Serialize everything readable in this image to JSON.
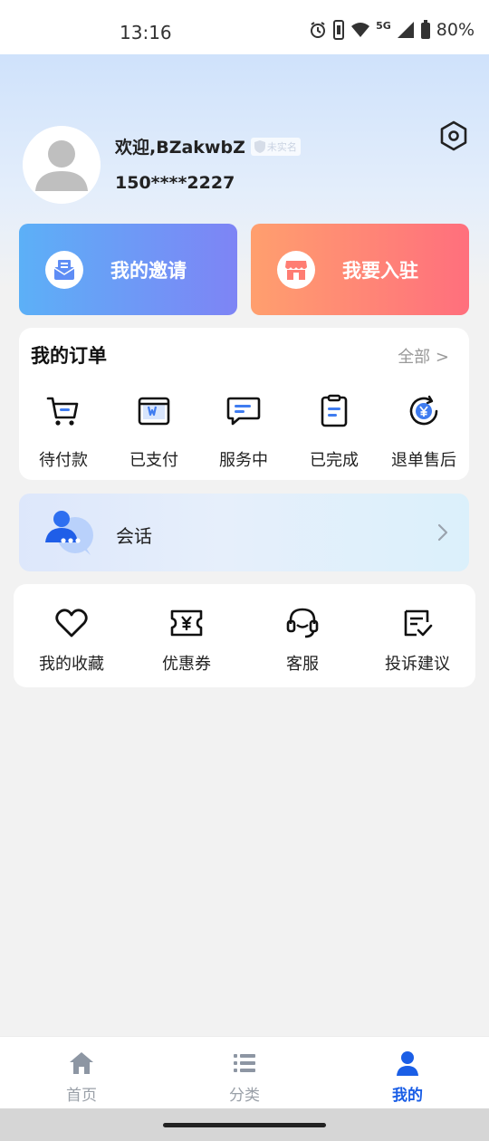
{
  "status_bar": {
    "time": "13:16",
    "network": "5G",
    "battery": "80%"
  },
  "profile": {
    "welcome": "欢迎,BZakwbZ",
    "verify_badge": "未实名",
    "phone": "150****2227"
  },
  "promos": {
    "invite_label": "我的邀请",
    "join_label": "我要入驻"
  },
  "orders": {
    "title": "我的订单",
    "all_label": "全部 >",
    "items": [
      {
        "label": "待付款",
        "icon": "cart-icon"
      },
      {
        "label": "已支付",
        "icon": "paid-wallet-icon"
      },
      {
        "label": "服务中",
        "icon": "chat-bubble-icon"
      },
      {
        "label": "已完成",
        "icon": "clipboard-icon"
      },
      {
        "label": "退单售后",
        "icon": "refund-yen-icon"
      }
    ]
  },
  "chat": {
    "label": "会话"
  },
  "services": {
    "items": [
      {
        "label": "我的收藏",
        "icon": "heart-icon"
      },
      {
        "label": "优惠券",
        "icon": "coupon-icon"
      },
      {
        "label": "客服",
        "icon": "headset-icon"
      },
      {
        "label": "投诉建议",
        "icon": "feedback-icon"
      }
    ]
  },
  "tabbar": {
    "items": [
      {
        "label": "首页",
        "icon": "home-icon"
      },
      {
        "label": "分类",
        "icon": "list-icon"
      },
      {
        "label": "我的",
        "icon": "user-icon"
      }
    ],
    "active": "我的"
  },
  "colors": {
    "accent": "#1a5ee6",
    "invite_gradient_start": "#5cb0f7",
    "invite_gradient_end": "#7e84f5",
    "join_gradient_start": "#ff9f6e",
    "join_gradient_end": "#ff6f7d"
  }
}
